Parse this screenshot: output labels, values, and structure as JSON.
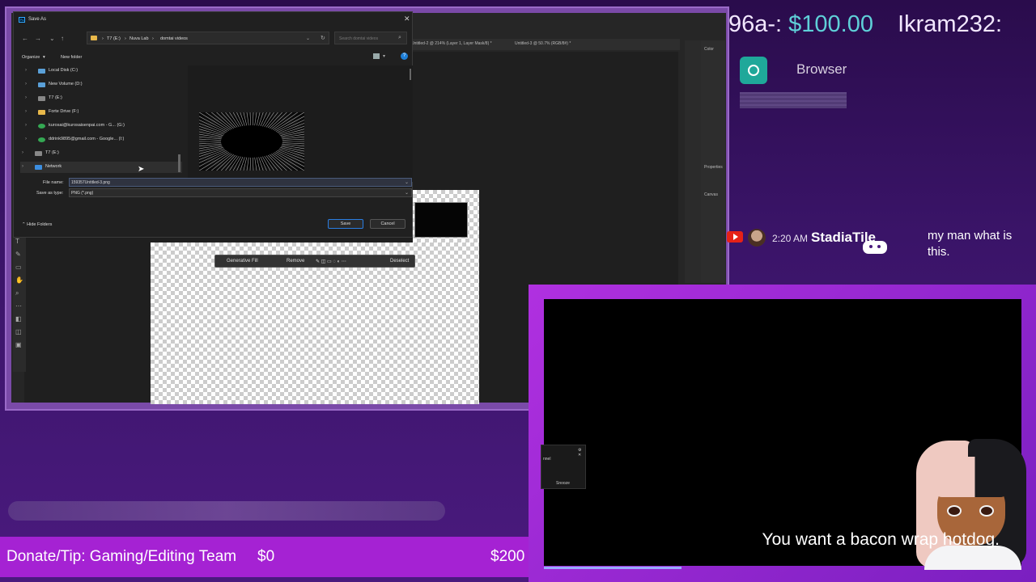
{
  "photoshop": {
    "tabs": [
      "Untitled-2 @ 214% (Layer 1, Layer Mask/8) *",
      "Untitled-3 @ 50.7% (RGB/8#) *"
    ],
    "right_panel": {
      "color_label": "Color",
      "properties_label": "Properties",
      "canvas_label": "Canvas"
    },
    "context_taskbar": {
      "generative_fill": "Generative Fill",
      "remove": "Remove",
      "deselect": "Deselect"
    }
  },
  "save_dialog": {
    "title": "Save As",
    "path": [
      "T7 (E:)",
      "Nuva Lab",
      "domtai videos"
    ],
    "search_placeholder": "Search domtai videos",
    "organize": "Organize",
    "new_folder": "New folder",
    "tree": [
      {
        "label": "Local Disk (C:)",
        "color": "#5aa0d8"
      },
      {
        "label": "New Volume (D:)",
        "color": "#5aa0d8"
      },
      {
        "label": "T7 (E:)",
        "color": "#888888"
      },
      {
        "label": "Forte Drive (F:)",
        "color": "#e8b84a"
      },
      {
        "label": "kurosai@kurosaisenpai.com - G... (G:)",
        "color": "#34a853"
      },
      {
        "label": "ddrink9895@gmail.com - Google... (I:)",
        "color": "#34a853"
      },
      {
        "label": "T7 (E:)",
        "color": "#888888"
      },
      {
        "label": "Network",
        "color": "#3c8ee0"
      }
    ],
    "file_name_label": "File name:",
    "file_name_value": "159357Untitled-3.png",
    "save_type_label": "Save as type:",
    "save_type_value": "PNG (*.png)",
    "hide_folders": "Hide Folders",
    "save_button": "Save",
    "cancel_button": "Cancel"
  },
  "overlay": {
    "donor_name_1": "96a-:",
    "donor_amount_1": "$100.00",
    "donor_name_2": "Ikram232:",
    "browser_label": "Browser",
    "chat": {
      "time": "2:20 AM",
      "user": "StadiaTile",
      "message": "my man what is this."
    },
    "mini_popup_title": "nnel",
    "mini_popup_button": "Snooze",
    "caption": "You want a bacon wrap hotdog.",
    "donate": {
      "label": "Donate/Tip: Gaming/Editing Team",
      "current": "$0",
      "goal": "$200"
    }
  }
}
